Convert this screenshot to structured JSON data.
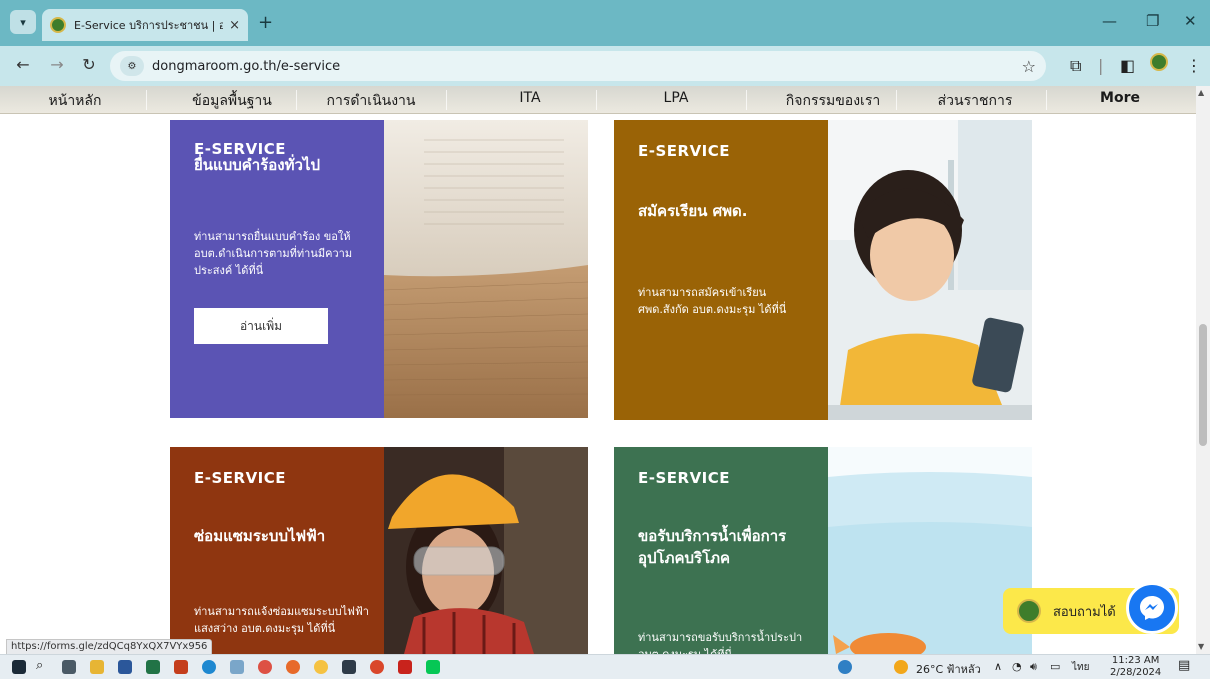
{
  "browser": {
    "tab_title": "E-Service บริการประชาชน | อบต.ดงมะรุม",
    "tab_close": "×",
    "new_tab": "+",
    "url": "dongmaroom.go.th/e-service",
    "window_controls": [
      "—",
      "❐",
      "✕"
    ]
  },
  "nav": {
    "items": [
      "หน้าหลัก",
      "ข้อมูลพื้นฐาน",
      "การดำเนินงาน",
      "ITA",
      "LPA",
      "กิจกรรมของเรา",
      "ส่วนราชการ",
      "More"
    ]
  },
  "cards": [
    {
      "eyebrow": "E-SERVICE",
      "heading": "ยื่นแบบคำร้องทั่วไป",
      "desc": "ท่านสามารถยื่นแบบคำร้อง ขอให้ อบต.ดำเนินการตามที่ท่านมีความประสงค์ ได้ที่นี่",
      "button": "อ่านเพิ่ม",
      "color": "#5b54b4"
    },
    {
      "eyebrow": "E-SERVICE",
      "heading": "สมัครเรียน ศพด.",
      "desc": "ท่านสามารถสมัครเข้าเรียน ศพด.สังกัด อบต.ดงมะรุม ได้ที่นี่",
      "color": "#9a6306"
    },
    {
      "eyebrow": "E-SERVICE",
      "heading": "ซ่อมแซมระบบไฟฟ้า",
      "desc": "ท่านสามารถแจ้งซ่อมแซมระบบไฟฟ้า แสงสว่าง อบต.ดงมะรุม ได้ที่นี่",
      "color": "#8f3610"
    },
    {
      "eyebrow": "E-SERVICE",
      "heading": "ขอรับบริการน้ำเพื่อการอุปโภคบริโภค",
      "desc": "ท่านสามารถขอรับบริการน้ำประปา อบต.ดงมะรุม ได้ที่นี่",
      "color": "#3d7251"
    }
  ],
  "status_url": "https://forms.gle/zdQCq8YxQX7VYx956",
  "chat": {
    "label": "สอบถามได้"
  },
  "taskbar": {
    "weather": "26°C ฟ้าหลัว",
    "lang": "ไทย",
    "time": "11:23 AM",
    "date": "2/28/2024"
  }
}
